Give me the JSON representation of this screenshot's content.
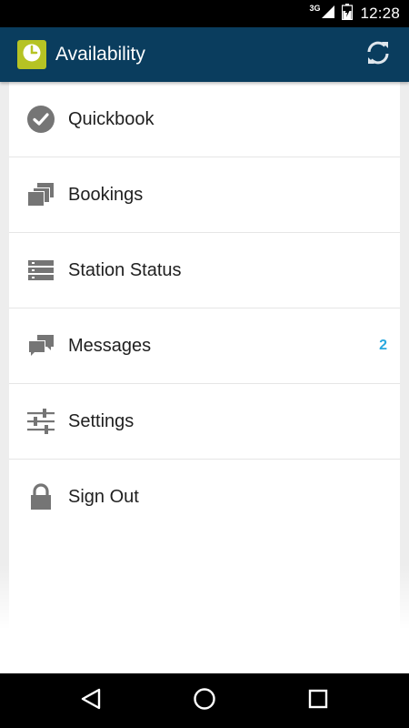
{
  "status_bar": {
    "network": "3G",
    "time": "12:28"
  },
  "app_bar": {
    "title": "Availability",
    "logo_icon": "clock-icon",
    "action_icon": "refresh-icon",
    "color": "#0a3d5e",
    "logo_color": "#b6c324"
  },
  "menu": {
    "items": [
      {
        "label": "Quickbook",
        "icon": "check-circle-icon"
      },
      {
        "label": "Bookings",
        "icon": "stacked-cards-icon"
      },
      {
        "label": "Station Status",
        "icon": "server-list-icon"
      },
      {
        "label": "Messages",
        "icon": "chat-bubbles-icon",
        "badge": "2"
      },
      {
        "label": "Settings",
        "icon": "sliders-icon"
      },
      {
        "label": "Sign Out",
        "icon": "lock-icon"
      }
    ],
    "badge_color": "#29a8de"
  },
  "nav_bar": {
    "buttons": [
      "back-icon",
      "home-icon",
      "recents-icon"
    ]
  }
}
